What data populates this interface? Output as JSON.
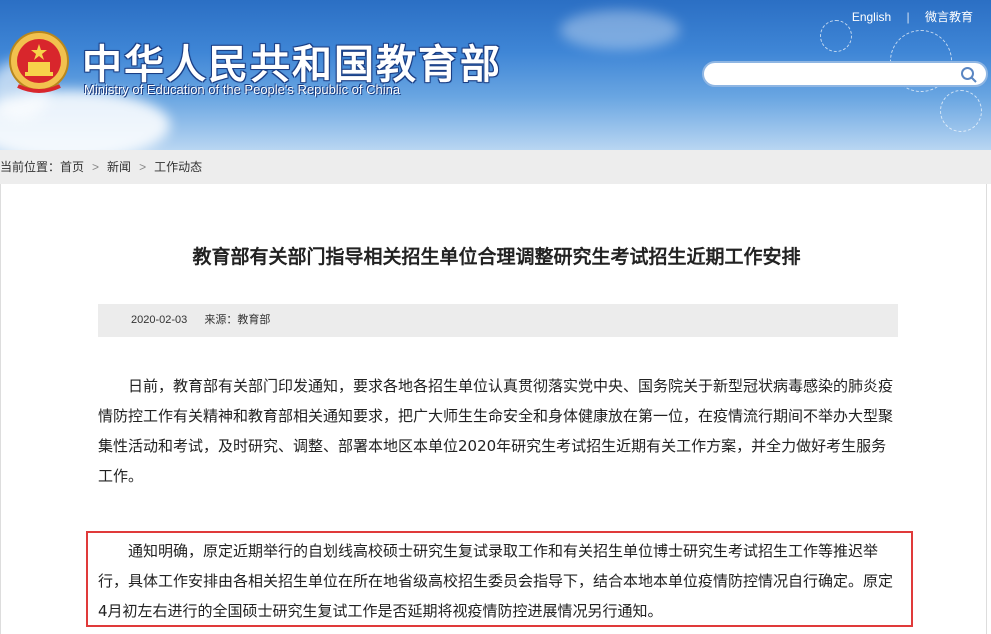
{
  "header": {
    "logo_cn": "中华人民共和国教育部",
    "logo_en": "Ministry of Education of the People's Republic of China",
    "links": [
      "English",
      "微言教育"
    ],
    "search_placeholder": ""
  },
  "breadcrumb": {
    "label": "当前位置：",
    "items": [
      "首页",
      "新闻",
      "工作动态"
    ]
  },
  "article": {
    "title": "教育部有关部门指导相关招生单位合理调整研究生考试招生近期工作安排",
    "date": "2020-02-03",
    "source": "来源：教育部",
    "paragraphs": [
      "日前，教育部有关部门印发通知，要求各地各招生单位认真贯彻落实党中央、国务院关于新型冠状病毒感染的肺炎疫情防控工作有关精神和教育部相关通知要求，把广大师生生命安全和身体健康放在第一位，在疫情流行期间不举办大型聚集性活动和考试，及时研究、调整、部署本地区本单位2020年研究生考试招生近期有关工作方案，并全力做好考生服务工作。",
      "通知明确，原定近期举行的自划线高校硕士研究生复试录取工作和有关招生单位博士研究生考试招生工作等推迟举行，具体工作安排由各相关招生单位在所在地省级高校招生委员会指导下，结合本地本单位疫情防控情况自行确定。原定4月初左右进行的全国硕士研究生复试工作是否延期将视疫情防控进展情况另行通知。"
    ]
  },
  "colors": {
    "highlight_border": "#e03a3a",
    "header_blue": "#3f86d6"
  },
  "icons": [
    "national-emblem-icon",
    "search-icon",
    "chevron-right-icon"
  ]
}
